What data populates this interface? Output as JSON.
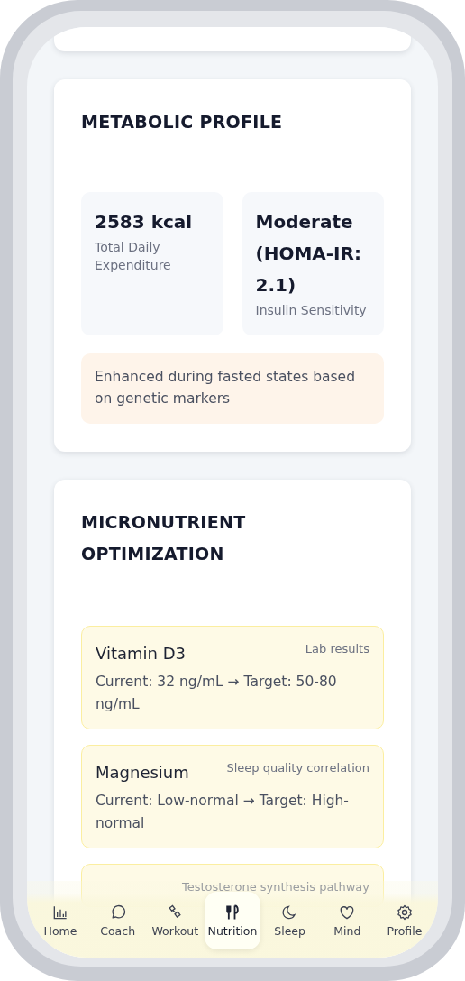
{
  "metabolic_profile": {
    "title": "METABOLIC PROFILE",
    "stats": [
      {
        "value": "2583 kcal",
        "label": "Total Daily Expenditure"
      },
      {
        "value": "Moderate (HOMA-IR: 2.1)",
        "label": "Insulin Sensitivity"
      }
    ],
    "note": "Enhanced during fasted states based on genetic markers"
  },
  "micronutrients": {
    "title": "MICRONUTRIENT OPTIMIZATION",
    "items": [
      {
        "name": "Vitamin D3",
        "source": "Lab results",
        "detail": "Current: 32 ng/mL → Target: 50-80 ng/mL"
      },
      {
        "name": "Magnesium",
        "source": "Sleep quality correlation",
        "detail": "Current: Low-normal → Target: High-normal"
      },
      {
        "source": "Testosterone synthesis pathway"
      }
    ]
  },
  "nav": [
    {
      "label": "Home",
      "selected": false
    },
    {
      "label": "Coach",
      "selected": false
    },
    {
      "label": "Workout",
      "selected": false
    },
    {
      "label": "Nutrition",
      "selected": true
    },
    {
      "label": "Sleep",
      "selected": false
    },
    {
      "label": "Mind",
      "selected": false
    },
    {
      "label": "Profile",
      "selected": false
    }
  ]
}
